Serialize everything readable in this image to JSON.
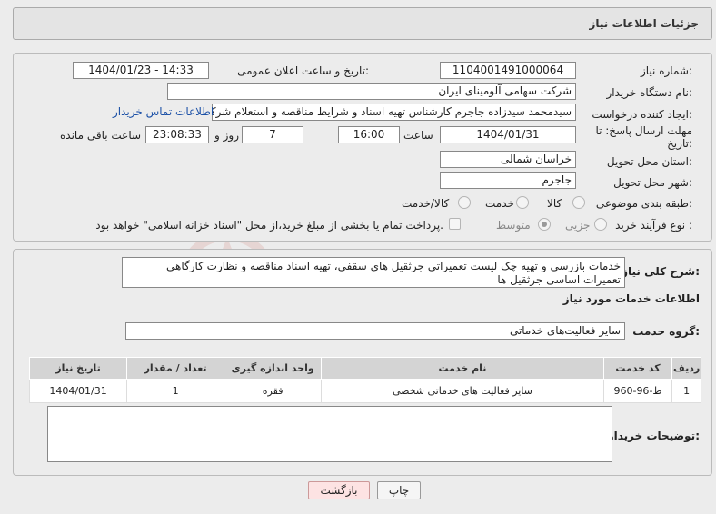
{
  "header": {
    "title": "جزئیات اطلاعات نیاز"
  },
  "form": {
    "need_number": {
      "label": "شماره نیاز:",
      "value": "1104001491000064"
    },
    "announce": {
      "label": "تاریخ و ساعت اعلان عمومی:",
      "value": "1404/01/23 - 14:33"
    },
    "buyer_org": {
      "label": "نام دستگاه خریدار:",
      "value": "شرکت سهامی آلومینای ایران"
    },
    "requester": {
      "label": "ایجاد کننده درخواست:",
      "value": "سیدمحمد سیدزاده جاجرم کارشناس تهیه اسناد و شرایط  مناقصه و استعلام شرکت",
      "contact_link": "اطلاعات تماس خریدار"
    },
    "deadline": {
      "label_line1": "مهلت ارسال پاسخ: تا",
      "label_line2": "تاریخ:",
      "date": "1404/01/31",
      "time_label": "ساعت",
      "time": "16:00",
      "days": "7",
      "days_label": "روز و",
      "remaining": "23:08:33",
      "remaining_label": "ساعت باقی مانده"
    },
    "province": {
      "label": "استان محل تحویل:",
      "value": "خراسان شمالی"
    },
    "city": {
      "label": "شهر محل تحویل:",
      "value": "جاجرم"
    },
    "category": {
      "label": "طبقه بندی موضوعی:",
      "options": [
        "کالا",
        "خدمت",
        "کالا/خدمت"
      ],
      "selected": "خدمت"
    },
    "process": {
      "label": "نوع فرآیند خرید :",
      "options": [
        "جزیی",
        "متوسط"
      ],
      "selected": "متوسط",
      "payment_note": "پرداخت تمام یا بخشی از مبلغ خرید،از محل \"اسناد خزانه اسلامی\" خواهد بود."
    }
  },
  "description": {
    "label": "شرح کلی نیاز:",
    "value": "خدمات بازرسی و تهیه چک لیست تعمیراتی جرثقیل های سقفی، تهیه اسناد مناقصه و نظارت کارگاهی تعمیرات اساسی جرثقیل ها"
  },
  "services": {
    "section_title": "اطلاعات خدمات مورد نیاز",
    "group_label": "گروه خدمت:",
    "group_value": "سایر فعالیت‌های خدماتی",
    "columns": [
      "ردیف",
      "کد خدمت",
      "نام خدمت",
      "واحد اندازه گیری",
      "تعداد / مقدار",
      "تاریخ نیاز"
    ],
    "rows": [
      [
        "1",
        "ط-96-960",
        "سایر فعالیت های خدماتی شخصی",
        "فقره",
        "1",
        "1404/01/31"
      ]
    ]
  },
  "buyer_notes": {
    "label": "توضیحات خریدار:",
    "value": ""
  },
  "buttons": {
    "print": "چاپ",
    "back": "بازگشت"
  },
  "watermark": {
    "text": "AriaTender.neT"
  },
  "colors": {
    "link": "#1a4fa6",
    "header_bg": "#e4e4e4",
    "back_button": "#fde3e3"
  }
}
